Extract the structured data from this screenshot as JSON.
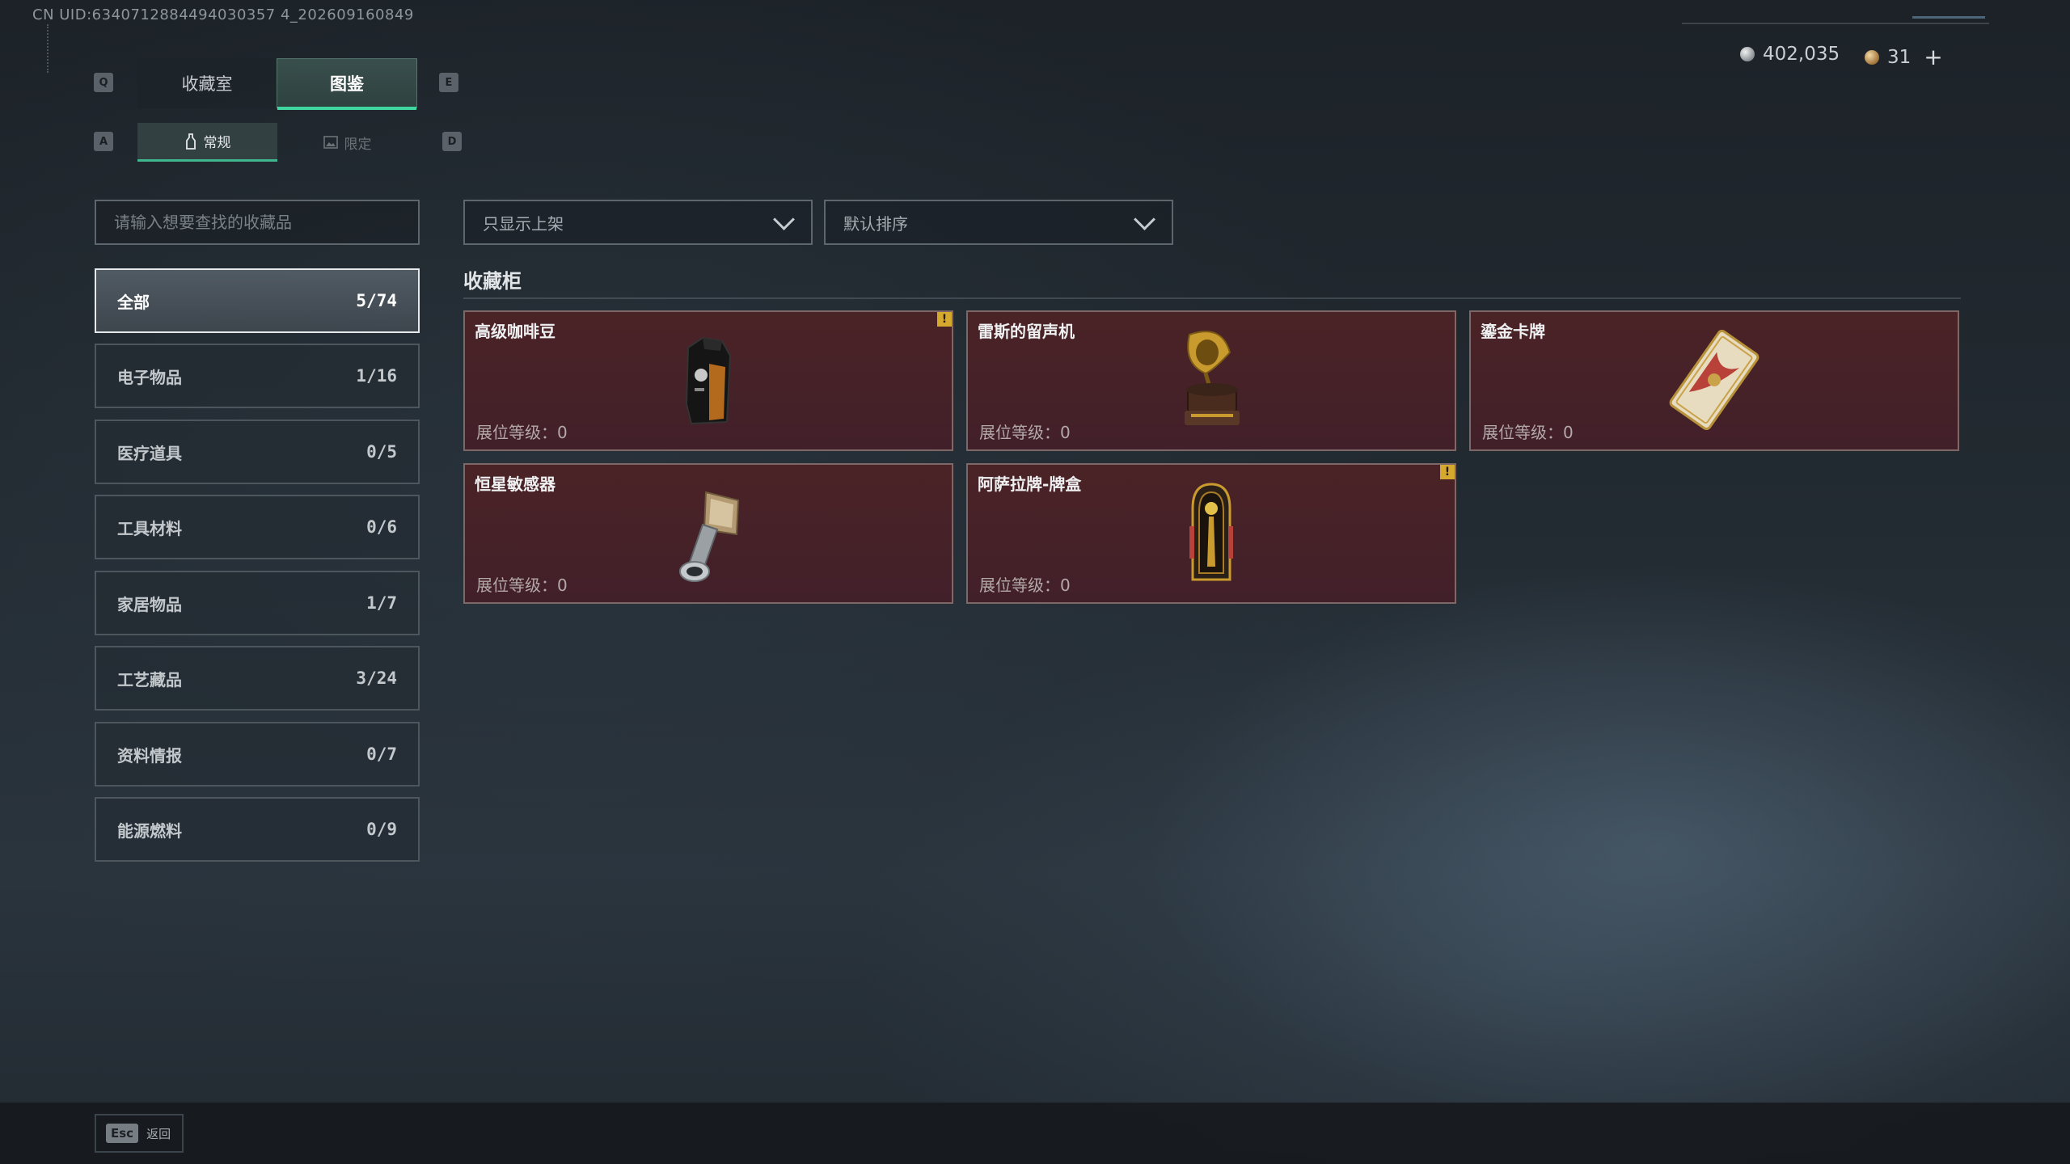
{
  "uid_text": "CN UID:6340712884494030357 4_202609160849",
  "tabs": {
    "key_left": "Q",
    "key_right": "E",
    "items": [
      {
        "label": "收藏室"
      },
      {
        "label": "图鉴"
      }
    ],
    "active": 1
  },
  "subtabs": {
    "key_left": "A",
    "key_right": "D",
    "items": [
      {
        "label": "常规"
      },
      {
        "label": "限定"
      }
    ],
    "active": 0
  },
  "currency": {
    "silver": "402,035",
    "gold": "31",
    "plus": "+"
  },
  "search": {
    "placeholder": "请输入想要查找的收藏品",
    "value": ""
  },
  "categories": [
    {
      "label": "全部",
      "count": "5/74"
    },
    {
      "label": "电子物品",
      "count": "1/16"
    },
    {
      "label": "医疗道具",
      "count": "0/5"
    },
    {
      "label": "工具材料",
      "count": "0/6"
    },
    {
      "label": "家居物品",
      "count": "1/7"
    },
    {
      "label": "工艺藏品",
      "count": "3/24"
    },
    {
      "label": "资料情报",
      "count": "0/7"
    },
    {
      "label": "能源燃料",
      "count": "0/9"
    }
  ],
  "filters": {
    "display": "只显示上架",
    "sort": "默认排序"
  },
  "section_title": "收藏柜",
  "cards": [
    {
      "name": "高级咖啡豆",
      "level": "展位等级：0",
      "warn": "!"
    },
    {
      "name": "雷斯的留声机",
      "level": "展位等级：0",
      "warn": ""
    },
    {
      "name": "鎏金卡牌",
      "level": "展位等级：0",
      "warn": ""
    },
    {
      "name": "恒星敏感器",
      "level": "展位等级：0",
      "warn": ""
    },
    {
      "name": "阿萨拉牌-牌盒",
      "level": "展位等级：0",
      "warn": "!"
    }
  ],
  "footer": {
    "esc_key": "Esc",
    "esc_label": "返回"
  },
  "colors": {
    "accent": "#3fd6a0",
    "card_bg": "#4a2326",
    "warn": "#d4a92d"
  }
}
